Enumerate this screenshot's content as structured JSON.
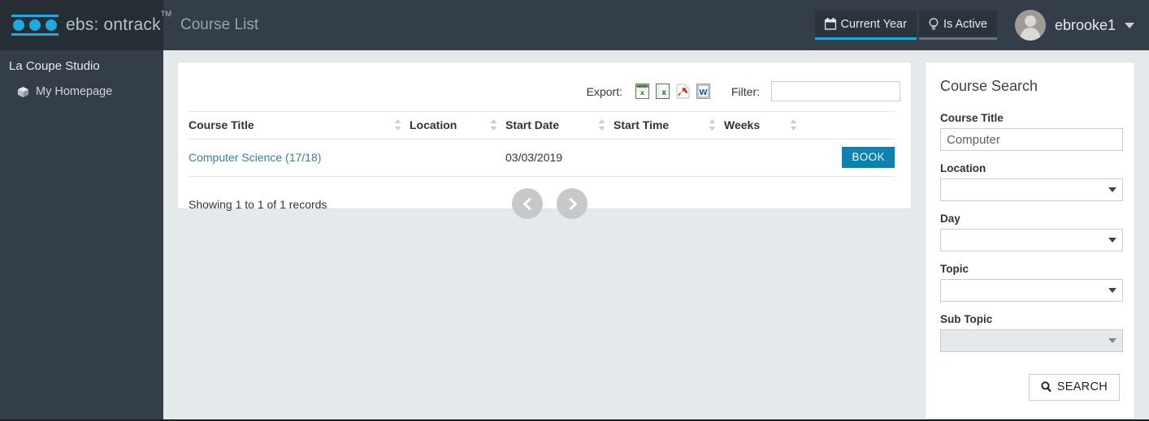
{
  "brand": {
    "name": "ebs: ontrack",
    "trademark": "TM",
    "logo_color": "#22a7e0"
  },
  "header": {
    "page_title": "Course List",
    "context_buttons": [
      {
        "label": "Current Year",
        "icon": "calendar-icon",
        "active": true,
        "underline_color": "#22a7e0"
      },
      {
        "label": "Is Active",
        "icon": "lightbulb-icon",
        "active": false,
        "underline_color": "#6c757d"
      }
    ],
    "user": {
      "name": "ebrooke1",
      "avatar": "user-avatar"
    }
  },
  "sidebar": {
    "title": "La Coupe Studio",
    "items": [
      {
        "label": "My Homepage",
        "icon": "cube-icon"
      }
    ]
  },
  "toolbar": {
    "export_label": "Export:",
    "export_icons": [
      "export-xml-icon",
      "export-excel-icon",
      "export-pdf-icon",
      "export-word-icon"
    ],
    "filter_label": "Filter:",
    "filter_value": "",
    "filter_placeholder": ""
  },
  "table": {
    "columns": [
      "Course Title",
      "Location",
      "Start Date",
      "Start Time",
      "Weeks",
      ""
    ],
    "rows": [
      {
        "course_title": "Computer Science (17/18)",
        "location": "",
        "start_date": "03/03/2019",
        "start_time": "",
        "weeks": "",
        "action_label": "BOOK"
      }
    ],
    "records_text": "Showing 1 to 1 of 1 records",
    "pagination": {
      "prev": "previous-page",
      "next": "next-page"
    }
  },
  "search_panel": {
    "title": "Course Search",
    "fields": [
      {
        "label": "Course Title",
        "type": "text",
        "value": "Computer",
        "disabled": false
      },
      {
        "label": "Location",
        "type": "select",
        "value": "",
        "disabled": false
      },
      {
        "label": "Day",
        "type": "select",
        "value": "",
        "disabled": false
      },
      {
        "label": "Topic",
        "type": "select",
        "value": "",
        "disabled": false
      },
      {
        "label": "Sub Topic",
        "type": "select",
        "value": "",
        "disabled": true
      }
    ],
    "search_button": {
      "label": "SEARCH",
      "icon": "magnifier-icon"
    }
  },
  "colors": {
    "topbar": "#343e48",
    "brand_bg": "#262d34",
    "accent": "#22a7e0",
    "book_button": "#0e82ad",
    "link": "#3a7ca5",
    "page_bg": "#e4e9ec"
  }
}
